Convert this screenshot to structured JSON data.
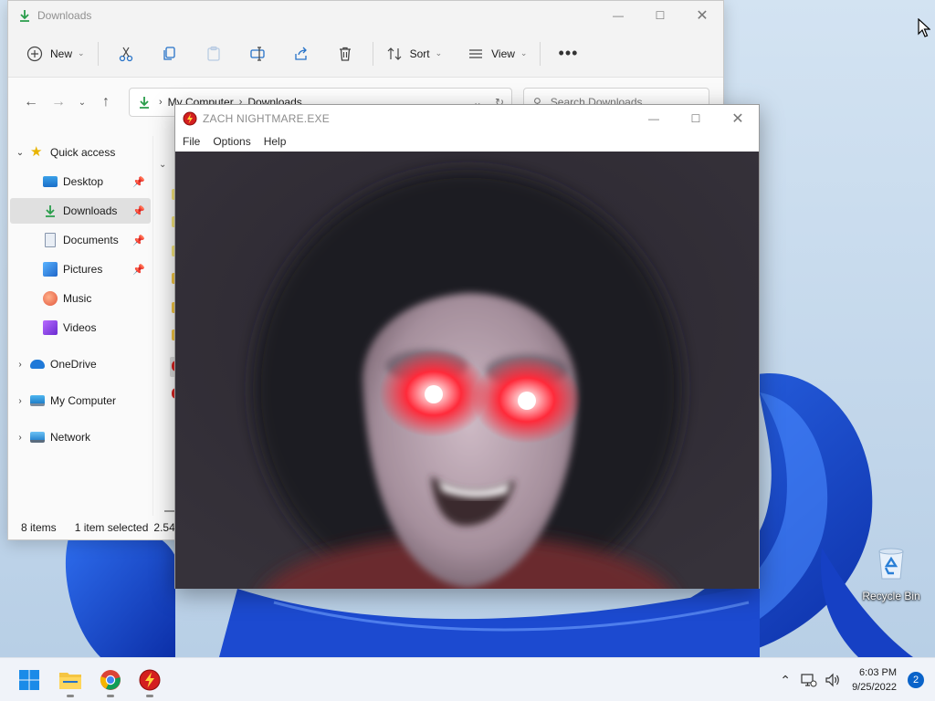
{
  "explorer": {
    "title": "Downloads",
    "toolbar": {
      "new_label": "New",
      "sort_label": "Sort",
      "view_label": "View"
    },
    "address": {
      "crumbs": [
        "My Computer",
        "Downloads"
      ]
    },
    "search_placeholder": "Search Downloads",
    "nav": {
      "quick_access": "Quick access",
      "desktop": "Desktop",
      "downloads": "Downloads",
      "documents": "Documents",
      "pictures": "Pictures",
      "music": "Music",
      "videos": "Videos",
      "onedrive": "OneDrive",
      "my_computer": "My Computer",
      "network": "Network"
    },
    "status": {
      "items": "8 items",
      "selected": "1 item selected",
      "size": "2.54"
    }
  },
  "app": {
    "title": "ZACH NIGHTMARE.EXE",
    "menu": [
      "File",
      "Options",
      "Help"
    ]
  },
  "desktop": {
    "recycle_bin": "Recycle Bin"
  },
  "taskbar": {
    "time": "6:03 PM",
    "date": "9/25/2022",
    "notifications": "2"
  },
  "colors": {
    "accent": "#0a63c9",
    "wallpaper_blue": "#1f4fd6",
    "glow_red": "#ff2a3a"
  }
}
